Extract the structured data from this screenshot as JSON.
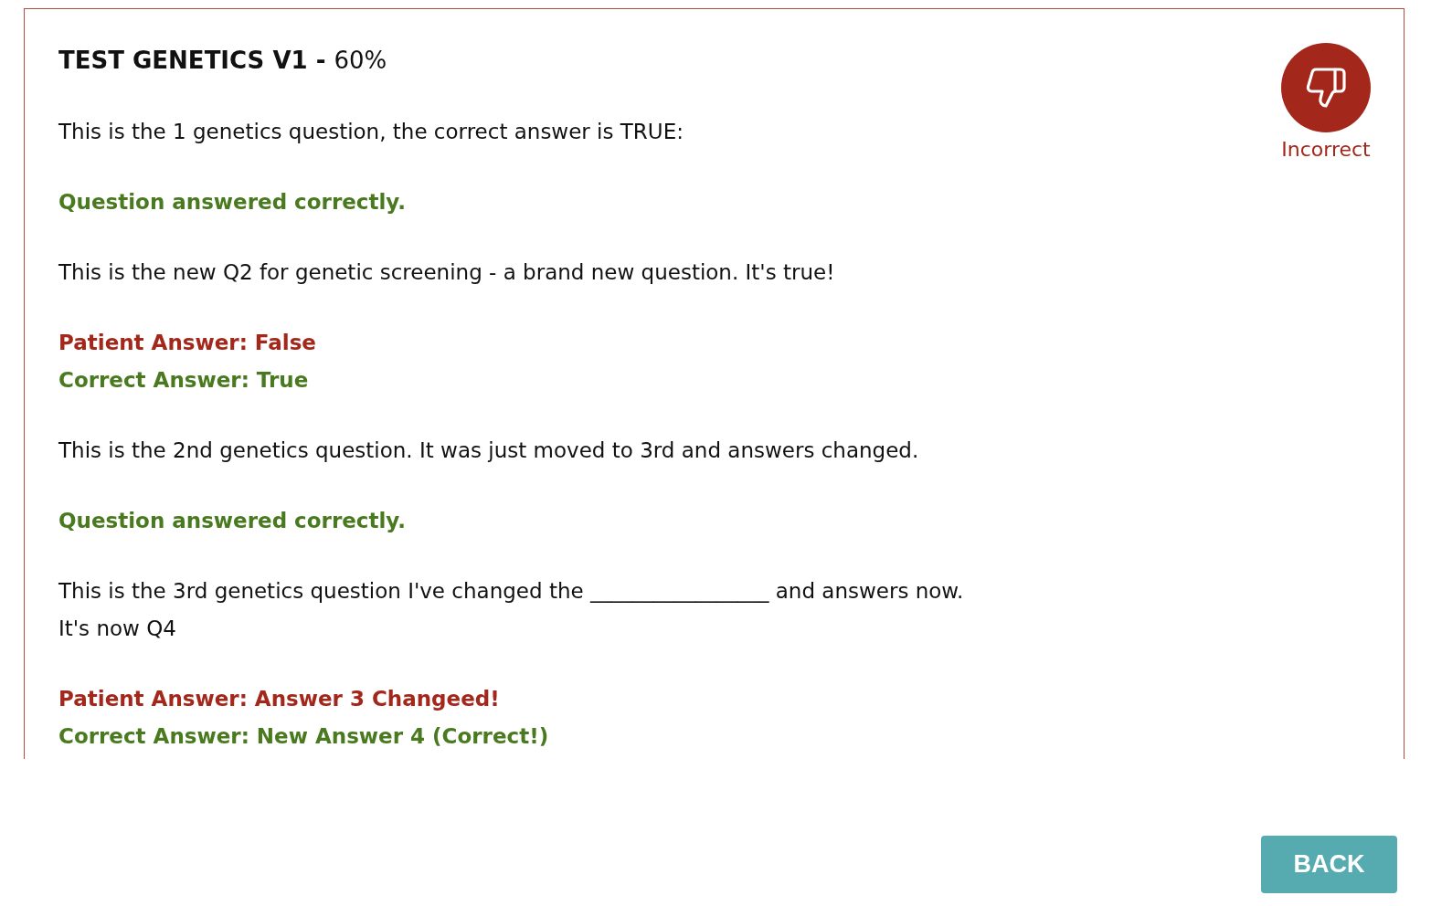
{
  "header": {
    "title": "TEST GENETICS V1 -",
    "score": "60%"
  },
  "verdict": {
    "kind": "incorrect",
    "label": "Incorrect"
  },
  "questions": [
    {
      "text": "This is the 1 genetics question, the correct answer is TRUE:",
      "result": {
        "kind": "correct",
        "note": "Question answered correctly."
      }
    },
    {
      "text": "This is the new Q2 for genetic screening - a brand new question. It's true!",
      "result": {
        "kind": "incorrect",
        "patient_answer": "Patient Answer: False",
        "correct_answer": "Correct Answer: True"
      }
    },
    {
      "text": "This is the 2nd genetics question. It was just moved to 3rd and answers changed.",
      "result": {
        "kind": "correct",
        "note": "Question answered correctly."
      }
    },
    {
      "text": "This is the 3rd genetics question I've changed the _________________ and answers now.\nIt's now Q4",
      "result": {
        "kind": "incorrect",
        "patient_answer": "Patient Answer: Answer 3 Changeed!",
        "correct_answer": "Correct Answer: New Answer 4 (Correct!)"
      }
    }
  ],
  "back_button": "BACK"
}
